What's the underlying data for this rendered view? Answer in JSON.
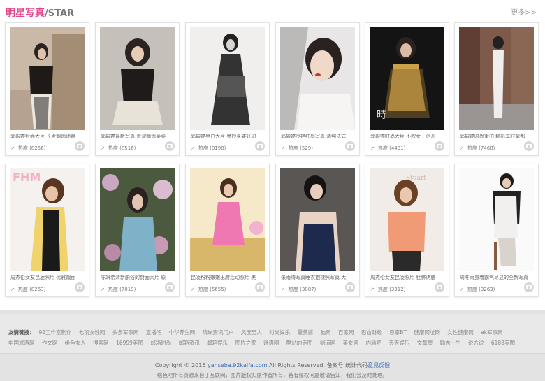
{
  "header": {
    "title_cn": "明星写真",
    "title_en": "/STAR",
    "more": "更多>>"
  },
  "cards": [
    {
      "caption": "郭碧婷封面大片 长发飘逸迷静",
      "heat": "热度 (8256)"
    },
    {
      "caption": "郭碧婷最新写真 青涩飘逸菜菜",
      "heat": "热度 (8516)"
    },
    {
      "caption": "郭碧婷黑白大片 曼妙身姿好幻",
      "heat": "热度 (8198)"
    },
    {
      "caption": "郭碧婷冷艳红唇写真 清纯法式",
      "heat": "热度 (529)"
    },
    {
      "caption": "郭碧婷时尚大片 不吹女王范儿",
      "heat": "热度 (4431)"
    },
    {
      "caption": "郭碧婷时尚街拍 精机车时髦都",
      "heat": "热度 (7468)"
    },
    {
      "caption": "周杰伦女友昆凌照片 优雅靓丽",
      "heat": "热度 (8263)"
    },
    {
      "caption": "陈妍希清新脱俗的封面大片 原",
      "heat": "热度 (7019)"
    },
    {
      "caption": "昆凌粉粉嫩嫩出席活动照片 美",
      "heat": "热度 (5655)"
    },
    {
      "caption": "张雨绮写真睡衣抱枕照写真 大",
      "heat": "热度 (3887)"
    },
    {
      "caption": "周杰伦女友昆凌照片 肚脐诱惑",
      "heat": "热度 (3312)"
    },
    {
      "caption": "周冬雨身着霸气尽显的全新写真",
      "heat": "热度 (3263)"
    }
  ],
  "links": {
    "label": "友情链接：",
    "items": [
      "92工作室制作",
      "七丽女性网",
      "头条军事网",
      "直播吧",
      "中华养生网",
      "晴岚资讯门户",
      "风度男人",
      "时尚娱乐",
      "最美酱",
      "脑网",
      "百家网",
      "巴山财经",
      "思享BT",
      "健康网址网",
      "女性健康网",
      "ak军事网",
      "中国旅游网",
      "作文网",
      "绝色女人",
      "搜索网",
      "16999美图",
      "邮箱时尚",
      "邮箱资讯",
      "邮箱娱乐",
      "图片之家",
      "谜语网",
      "酷站的走图",
      "剑道网",
      "美女网",
      "内涵吧",
      "天天娱乐",
      "文章屋",
      "励志一生",
      "说方说",
      "6188美图"
    ]
  },
  "footer": {
    "copyright_prefix": "Copyright © 2016",
    "domain": "yanseba.92kaifa.com",
    "rights": "All Rights Reserved.",
    "icp": "备案号",
    "stats": "统计代码",
    "report": "意见反馈",
    "disclaimer": "络色吧所有资源来自于互联网，图片版权归原作者所有，若有侵权问题敬请告知，我们会及时处理。"
  },
  "colors": {
    "accent_pink": "#e4478a",
    "link_blue": "#3a6fb5"
  }
}
